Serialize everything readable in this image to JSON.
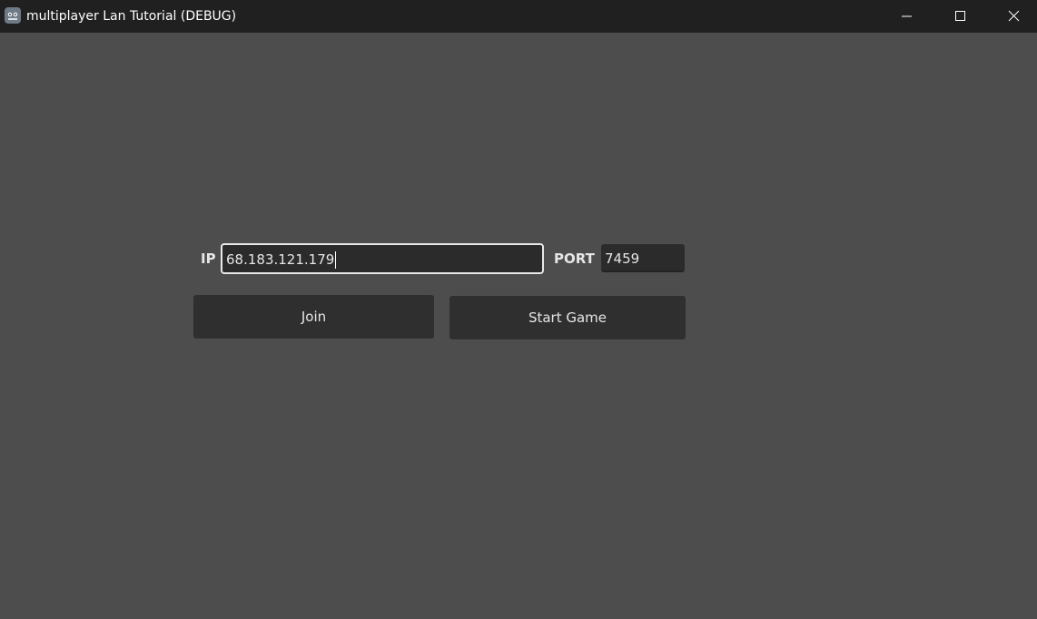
{
  "window": {
    "title": "multiplayer Lan Tutorial (DEBUG)",
    "icon": "godot-icon",
    "controls": [
      "minimize-icon",
      "maximize-icon",
      "close-icon"
    ]
  },
  "form": {
    "ip_label": "IP",
    "ip_value": "68.183.121.179",
    "port_label": "PORT",
    "port_value": "7459"
  },
  "buttons": {
    "join_label": "Join",
    "start_label": "Start Game"
  },
  "colors": {
    "background": "#4d4d4d",
    "titlebar": "#202020",
    "input_bg": "#2b2b2b",
    "button_bg": "#2f2f2f",
    "focus_border": "#e8e8e8"
  }
}
